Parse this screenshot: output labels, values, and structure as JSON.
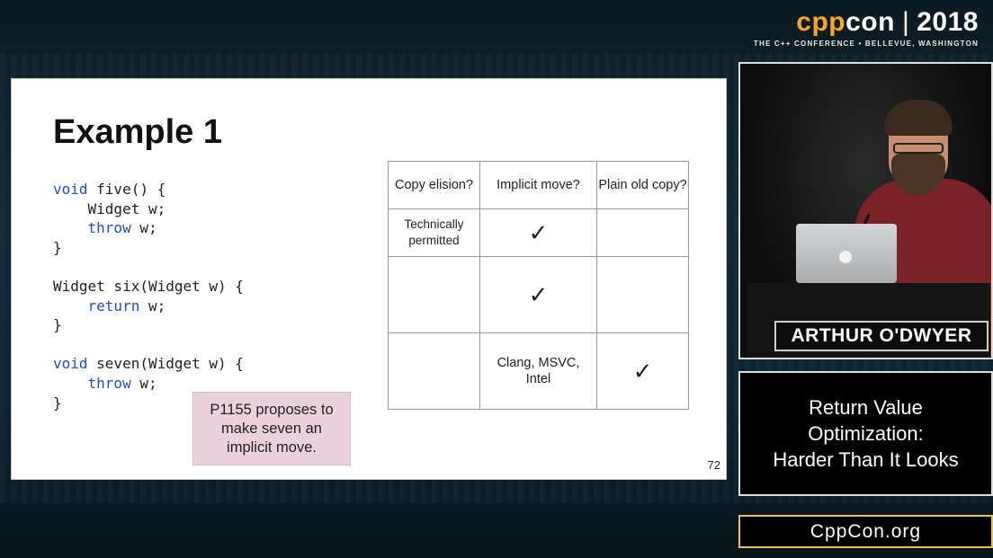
{
  "brand": {
    "cpp": "cpp",
    "con": "con",
    "separator": "|",
    "year": "2018",
    "tagline": "THE C++ CONFERENCE • BELLEVUE, WASHINGTON"
  },
  "slide": {
    "title": "Example 1",
    "page_number": "72",
    "note": "P1155 proposes to make seven an implicit move.",
    "table": {
      "headers": [
        "Copy elision?",
        "Implicit move?",
        "Plain old copy?"
      ],
      "rows": [
        [
          "Technically permitted",
          "✓",
          ""
        ],
        [
          "",
          "✓",
          ""
        ],
        [
          "",
          "Clang, MSVC, Intel",
          "✓"
        ]
      ]
    }
  },
  "speaker": {
    "name": "ARTHUR O'DWYER"
  },
  "talk": {
    "title_line1": "Return Value",
    "title_line2": "Optimization:",
    "title_line3": "Harder Than It Looks"
  },
  "site": {
    "url": "CppCon.org"
  },
  "colors": {
    "brand_accent": "#f5a623",
    "keyword_blue": "#1f4fbf",
    "note_background": "#ead1dc",
    "site_border": "#f0c040"
  }
}
